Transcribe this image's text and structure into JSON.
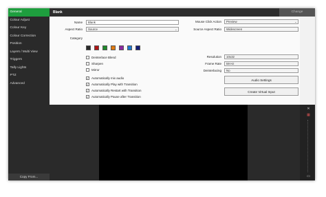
{
  "sidebar": {
    "items": [
      {
        "label": "General",
        "active": true
      },
      {
        "label": "Colour Adjust",
        "active": false
      },
      {
        "label": "Colour Key",
        "active": false
      },
      {
        "label": "Colour Correction",
        "active": false
      },
      {
        "label": "Position",
        "active": false
      },
      {
        "label": "Layers / Multi View",
        "active": false
      },
      {
        "label": "Triggers",
        "active": false
      },
      {
        "label": "Tally Lights",
        "active": false
      },
      {
        "label": "PTZ",
        "active": false
      },
      {
        "label": "Advanced",
        "active": false
      }
    ],
    "copy_from_label": "Copy From..."
  },
  "header": {
    "title": "Blank",
    "change_label": "Change"
  },
  "form": {
    "name_label": "Name",
    "name_value": "Blank",
    "aspect_ratio_label": "Aspect Ratio",
    "aspect_ratio_value": "Source",
    "category_label": "Category",
    "category_colors": [
      "#2a2a2a",
      "#b01515",
      "#1f8a2a",
      "#e07a10",
      "#8c2aa0",
      "#1f7ad0",
      "#141e78"
    ],
    "checkboxes": [
      {
        "label": "Deinterlace Blend",
        "checked": false
      },
      {
        "label": "Sharpen",
        "checked": false
      },
      {
        "label": "Mirror",
        "checked": false
      },
      {
        "label": "Automatically mix audio",
        "checked": true
      },
      {
        "label": "Automatically Play with Transition",
        "checked": true
      },
      {
        "label": "Automatically Restart with Transition",
        "checked": true
      },
      {
        "label": "Automatically Pause after Transition",
        "checked": true
      }
    ],
    "mouse_click_label": "Mouse Click Action",
    "mouse_click_value": "Preview",
    "source_aspect_label": "Source Aspect Ratio",
    "source_aspect_value": "Widescreen",
    "resolution_label": "Resolution",
    "resolution_value": "10x32",
    "frame_rate_label": "Frame Rate",
    "frame_rate_value": "59 Hz",
    "deinterlacing_label": "Deinterlacing",
    "deinterlacing_value": "No",
    "audio_settings_label": "Audio Settings",
    "create_virtual_input_label": "Create Virtual Input"
  },
  "tools": {
    "close_glyph": "✕",
    "layout_glyph": "▦",
    "bars_glyph": "▮▮",
    "bottom_glyph": "▭"
  }
}
